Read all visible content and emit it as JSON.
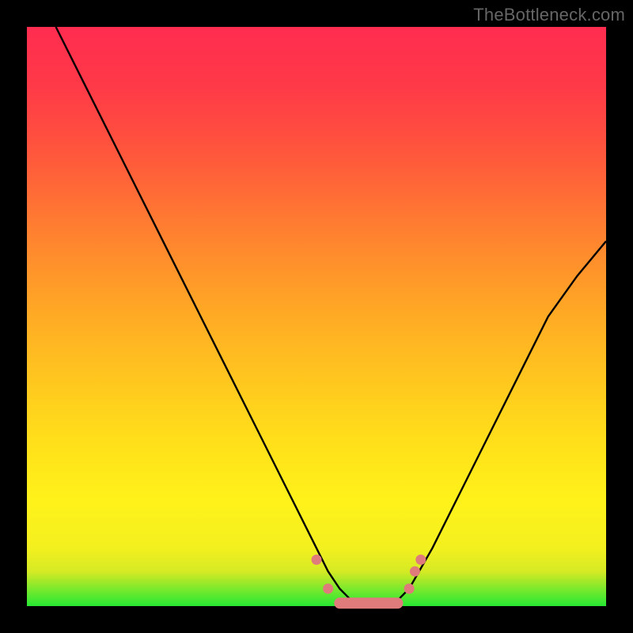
{
  "attribution": "TheBottleneck.com",
  "chart_data": {
    "type": "line",
    "title": "",
    "xlabel": "",
    "ylabel": "",
    "xlim": [
      0,
      100
    ],
    "ylim": [
      0,
      100
    ],
    "series": [
      {
        "name": "bottleneck-curve",
        "x": [
          5,
          10,
          15,
          20,
          25,
          30,
          35,
          40,
          45,
          50,
          52,
          54,
          56,
          58,
          60,
          62,
          64,
          66,
          70,
          75,
          80,
          85,
          90,
          95,
          100
        ],
        "y": [
          100,
          90,
          80,
          70,
          60,
          50,
          40,
          30,
          20,
          10,
          6,
          3,
          1,
          0,
          0,
          0,
          1,
          3,
          10,
          20,
          30,
          40,
          50,
          57,
          63
        ]
      }
    ],
    "markers": [
      {
        "name": "pt-left-a",
        "x": 50,
        "y": 8
      },
      {
        "name": "pt-left-b",
        "x": 52,
        "y": 3
      },
      {
        "name": "pt-right-a",
        "x": 66,
        "y": 3
      },
      {
        "name": "pt-right-b",
        "x": 67,
        "y": 6
      },
      {
        "name": "pt-right-c",
        "x": 68,
        "y": 8
      }
    ],
    "flat_segment": {
      "x0": 54,
      "x1": 64,
      "y": 0.5
    }
  }
}
